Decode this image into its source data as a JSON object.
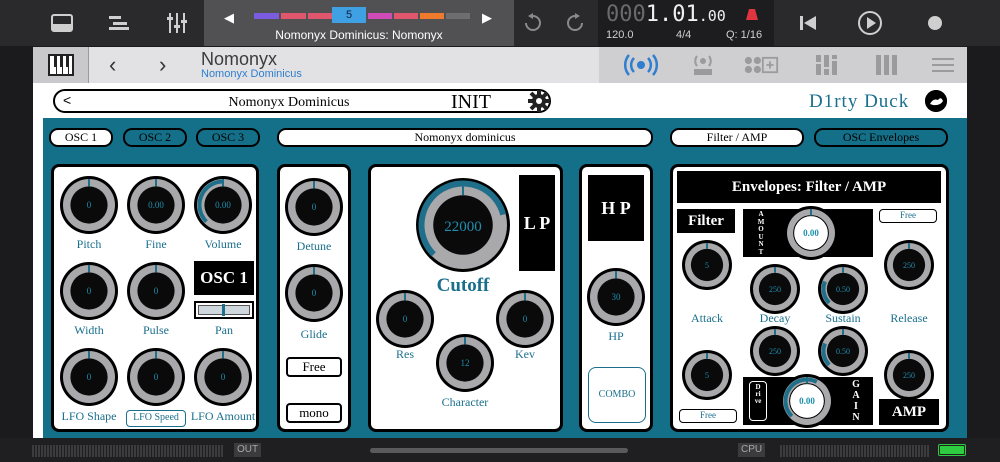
{
  "transport": {
    "song_number": "5",
    "song_title": "Nomonyx Dominicus: Nomonyx",
    "position_dim": "000",
    "position_main": "1.01",
    "position_tail": ".00",
    "tempo": "120.0",
    "time_signature": "4/4",
    "quantize": "Q: 1/16"
  },
  "plugin_header": {
    "instrument_name": "Nomonyx",
    "instrument_subtitle": "Nomonyx Dominicus"
  },
  "preset": {
    "prev": "<",
    "next": ">",
    "name": "Nomonyx Dominicus",
    "init_label": "INIT",
    "brand": "D1rty Duck"
  },
  "tabs": {
    "osc1": "OSC 1",
    "osc2": "OSC 2",
    "osc3": "OSC 3",
    "patch_name": "Nomonyx dominicus",
    "filter_amp": "Filter / AMP",
    "osc_envelopes": "OSC Envelopes"
  },
  "osc_panel": {
    "pitch": {
      "label": "Pitch",
      "value": "0"
    },
    "fine": {
      "label": "Fine",
      "value": "0.00"
    },
    "volume": {
      "label": "Volume",
      "value": "0.00"
    },
    "width": {
      "label": "Width",
      "value": "0"
    },
    "pulse": {
      "label": "Pulse",
      "value": "0"
    },
    "osc_badge": "OSC 1",
    "pan": {
      "label": "Pan"
    },
    "lfo_shape": {
      "label": "LFO Shape",
      "value": "0"
    },
    "lfo_speed": {
      "label": "LFO Speed",
      "value": "0"
    },
    "lfo_amount": {
      "label": "LFO Amount",
      "value": "0"
    }
  },
  "detune_panel": {
    "detune": {
      "label": "Detune",
      "value": "0"
    },
    "glide": {
      "label": "Glide",
      "value": "0"
    },
    "free_label": "Free",
    "mono_label": "mono"
  },
  "filter_panel": {
    "cutoff": {
      "label": "Cutoff",
      "value": "22000"
    },
    "mode_badge": "L P",
    "res": {
      "label": "Res",
      "value": "0"
    },
    "kev": {
      "label": "Kev",
      "value": "0"
    },
    "character": {
      "label": "Character",
      "value": "12"
    }
  },
  "hp_panel": {
    "badge": "H P",
    "hp": {
      "label": "HP",
      "value": "30"
    },
    "combo_label": "COMBO"
  },
  "env_panel": {
    "title": "Envelopes: Filter / AMP",
    "filter_badge": "Filter",
    "amount_vertical": "AMOUNT",
    "amount_value": "0.00",
    "free_top": "Free",
    "f_attack": {
      "label": "Attack",
      "value": "5"
    },
    "f_decay": {
      "label": "Decay",
      "value": "250"
    },
    "f_sustain": {
      "label": "Sustain",
      "value": "0.50"
    },
    "f_release": {
      "label": "Release",
      "value": "250"
    },
    "a_attack": {
      "value": "5"
    },
    "a_decay": {
      "value": "250"
    },
    "a_sustain": {
      "value": "0.50"
    },
    "a_release": {
      "value": "250"
    },
    "free_bottom": "Free",
    "drive_vertical": "Drive",
    "gain_vertical": "GAIN",
    "gain_value": "0.00",
    "amp_badge": "AMP"
  },
  "bottom": {
    "out_label": "OUT",
    "cpu_label": "CPU"
  },
  "colors": {
    "teal": "#146f88",
    "knob_text": "#1f8fb0",
    "accent_blue": "#3fa0e4"
  }
}
